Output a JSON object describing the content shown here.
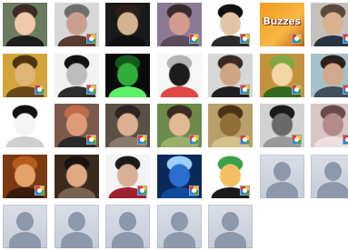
{
  "grid": {
    "tiles": [
      {
        "kind": "photo",
        "badge": false,
        "colors": [
          "#6a7c5f",
          "#f0c9a8",
          "#3a2a22",
          "#1d1d1d"
        ]
      },
      {
        "kind": "photo",
        "badge": true,
        "colors": [
          "#d8d8d8",
          "#c9a090",
          "#6e6e6e",
          "#5a3a30"
        ]
      },
      {
        "kind": "photo",
        "badge": false,
        "colors": [
          "#1a1a1a",
          "#d3b38f",
          "#2a1f1a",
          "#0f0f0f"
        ]
      },
      {
        "kind": "photo",
        "badge": true,
        "colors": [
          "#8a7a92",
          "#d19c8c",
          "#3a2a30",
          "#5a4a5a"
        ]
      },
      {
        "kind": "photo",
        "badge": true,
        "colors": [
          "#ffffff",
          "#e2c4a8",
          "#111111",
          "#2b2b2b"
        ]
      },
      {
        "kind": "buzz",
        "badge": true,
        "label": "Buzzes",
        "colors": [
          "#f39a1c",
          "#f7b746",
          "#a8470b",
          "#c85e12"
        ]
      },
      {
        "kind": "photo",
        "badge": true,
        "colors": [
          "#c4c1bb",
          "#d7b191",
          "#5b4a3c",
          "#273444"
        ]
      },
      {
        "kind": "photo",
        "badge": true,
        "colors": [
          "#d2a43a",
          "#e1b674",
          "#4e3410",
          "#6b4a1a"
        ]
      },
      {
        "kind": "photo",
        "badge": true,
        "colors": [
          "#f2f2f2",
          "#bdbdbd",
          "#111111",
          "#2e2e2e"
        ]
      },
      {
        "kind": "photo",
        "badge": false,
        "colors": [
          "#0a0a0a",
          "#2fae3a",
          "#115c19",
          "#5df06a"
        ]
      },
      {
        "kind": "photo",
        "badge": false,
        "colors": [
          "#f6f6f6",
          "#1c1c1c",
          "#b4b4b4",
          "#e04848"
        ]
      },
      {
        "kind": "photo",
        "badge": true,
        "colors": [
          "#d7d7d7",
          "#cfa584",
          "#3b2a22",
          "#1f1f1f"
        ]
      },
      {
        "kind": "photo",
        "badge": true,
        "colors": [
          "#c5923c",
          "#f2d6a4",
          "#7fa842",
          "#326a1e"
        ]
      },
      {
        "kind": "photo",
        "badge": true,
        "colors": [
          "#a7c1c9",
          "#d2a98c",
          "#2c1e18",
          "#3d4f58"
        ]
      },
      {
        "kind": "photo",
        "badge": false,
        "colors": [
          "#ffffff",
          "#f5f5f5",
          "#111111",
          "#cfcfcf"
        ]
      },
      {
        "kind": "photo",
        "badge": true,
        "colors": [
          "#7b5a4a",
          "#e09a7a",
          "#c06a4c",
          "#2a2a2a"
        ]
      },
      {
        "kind": "photo",
        "badge": true,
        "colors": [
          "#5a5046",
          "#dcb090",
          "#2b2420",
          "#8b7a6a"
        ]
      },
      {
        "kind": "photo",
        "badge": true,
        "colors": [
          "#6c8a4a",
          "#e3b894",
          "#3a2c20",
          "#9ab06a"
        ]
      },
      {
        "kind": "photo",
        "badge": true,
        "colors": [
          "#b9a06a",
          "#8f6e38",
          "#4a3318",
          "#d3c08a"
        ]
      },
      {
        "kind": "photo",
        "badge": true,
        "colors": [
          "#d2d2d2",
          "#6a6a6a",
          "#1a1a1a",
          "#9a9a9a"
        ]
      },
      {
        "kind": "photo",
        "badge": true,
        "colors": [
          "#d6c6c6",
          "#b48a8a",
          "#6a4a4a",
          "#ece0e0"
        ]
      },
      {
        "kind": "photo",
        "badge": true,
        "colors": [
          "#7a3a12",
          "#e4a26a",
          "#b85a1a",
          "#3a1a0a"
        ]
      },
      {
        "kind": "photo",
        "badge": false,
        "colors": [
          "#3a2a1e",
          "#e0a880",
          "#1a1210",
          "#7a6250"
        ]
      },
      {
        "kind": "photo",
        "badge": true,
        "colors": [
          "#f3f3f3",
          "#d8b096",
          "#1a1a1a",
          "#a02030"
        ]
      },
      {
        "kind": "photo",
        "badge": true,
        "colors": [
          "#0a2a5a",
          "#2b6fd0",
          "#9fd0ff",
          "#0f4a9a"
        ]
      },
      {
        "kind": "photo",
        "badge": true,
        "colors": [
          "#ffffff",
          "#f2c060",
          "#3aa04a",
          "#1a1a1a"
        ]
      },
      {
        "kind": "placeholder",
        "badge": false
      },
      {
        "kind": "placeholder",
        "badge": false
      },
      {
        "kind": "placeholder",
        "badge": false
      },
      {
        "kind": "placeholder",
        "badge": false
      },
      {
        "kind": "placeholder",
        "badge": false
      },
      {
        "kind": "placeholder",
        "badge": false
      },
      {
        "kind": "placeholder",
        "badge": false
      }
    ]
  }
}
